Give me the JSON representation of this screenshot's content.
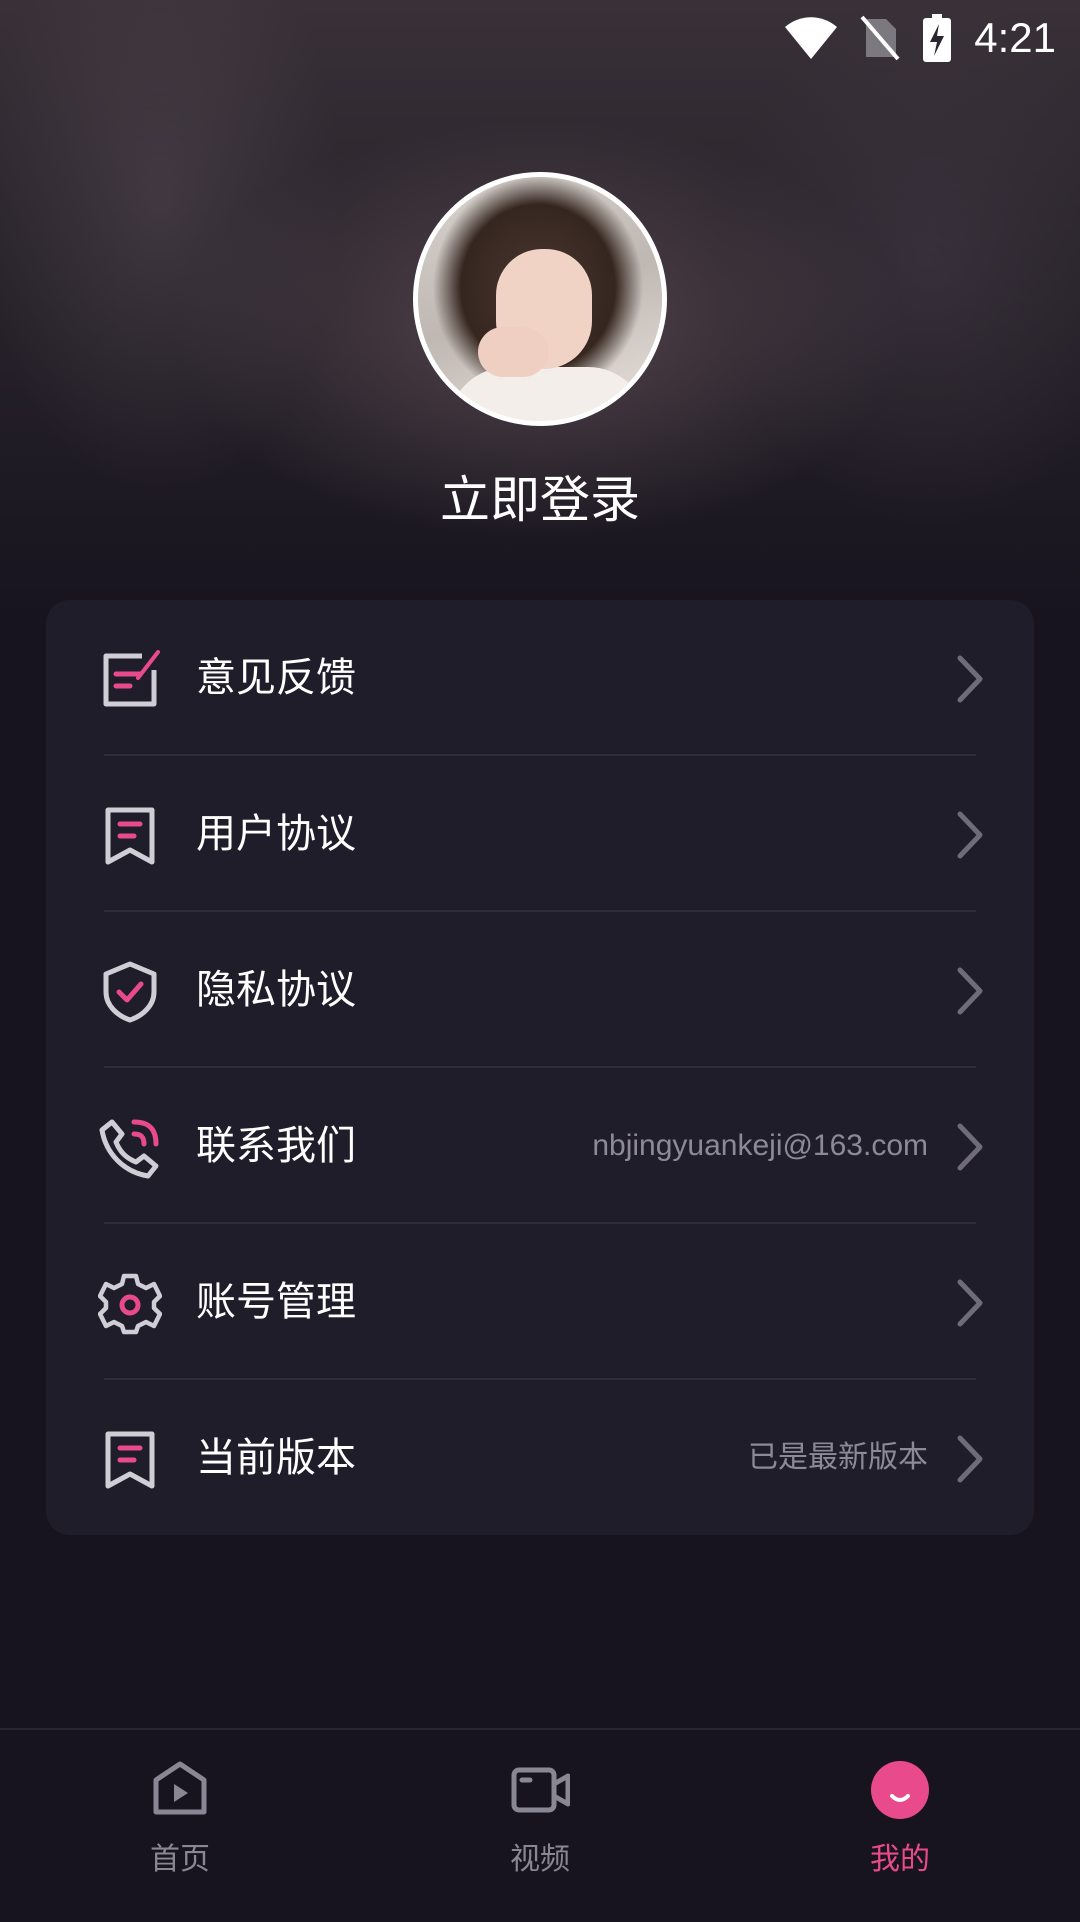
{
  "status_bar": {
    "time": "4:21",
    "icons": [
      "wifi-icon",
      "no-sim-icon",
      "battery-charging-icon"
    ]
  },
  "profile": {
    "login_label": "立即登录"
  },
  "menu": {
    "items": [
      {
        "label": "意见反馈",
        "value": "",
        "icon": "feedback-icon"
      },
      {
        "label": "用户协议",
        "value": "",
        "icon": "bookmark-doc-icon"
      },
      {
        "label": "隐私协议",
        "value": "",
        "icon": "shield-check-icon"
      },
      {
        "label": "联系我们",
        "value": "nbjingyuankeji@163.com",
        "icon": "phone-call-icon"
      },
      {
        "label": "账号管理",
        "value": "",
        "icon": "gear-icon"
      },
      {
        "label": "当前版本",
        "value": "已是最新版本",
        "icon": "bookmark-doc-icon"
      }
    ]
  },
  "tabbar": {
    "tabs": [
      {
        "label": "首页",
        "icon": "play-icon",
        "active": false
      },
      {
        "label": "视频",
        "icon": "video-camera-icon",
        "active": false
      },
      {
        "label": "我的",
        "icon": "smile-icon",
        "active": true
      }
    ]
  },
  "colors": {
    "accent": "#e94a8c",
    "card_bg": "#201d2b",
    "page_bg": "#17141f"
  }
}
